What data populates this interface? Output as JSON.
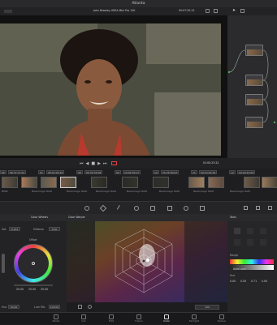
{
  "app": {
    "title": "Atlanta"
  },
  "viewer": {
    "clip_name": "John Brawley URSA Mini Pro 12K",
    "timecode_top": "00:07:20:13",
    "timecode": "01:00:23:22"
  },
  "timeline": {
    "chips": [
      "06",
      "06:37:11:01",
      "07",
      "06:07:09:16",
      "08",
      "05:32:32:09",
      "09",
      "10:02:39:17",
      "10",
      "15:25:00:07",
      "11",
      "04:14:02:16",
      "12",
      "04:24:22:02"
    ],
    "clips": [
      "BMW",
      "Blackmagic RAW",
      "Blackmagic RAW",
      "Blackmagic RAW",
      "Blackmagic RAW",
      "Blackmagic RAW",
      "Blackmagic RAW",
      "Blackmagic RAW"
    ]
  },
  "color_wheels": {
    "panel_title": "Color Wheels",
    "sat_label": "Sat.",
    "sat_value": "0.433",
    "midtone_label": "Midtone",
    "midtone_value": "0.00",
    "wheel_label": "Offset",
    "rgb_values": [
      "25.00",
      "25.00",
      "25.00"
    ],
    "hue_label": "Hue",
    "hue_value": "50.00",
    "lum_label": "Lum Mix",
    "lum_value": "100.00"
  },
  "warper": {
    "panel_title": "Color Warper",
    "zoom": "100"
  },
  "right_panel": {
    "tools_label": "Tools",
    "range_label": "Range",
    "hue_label": "Hue",
    "auto_label": "Auto Lock",
    "sat_values": [
      "0.00",
      "0.50",
      "0.71",
      "0.00"
    ]
  },
  "pages": [
    "Media",
    "Cut",
    "Edit",
    "Fusion",
    "Color",
    "Fairlight",
    "Deliver"
  ],
  "active_page": "Color"
}
